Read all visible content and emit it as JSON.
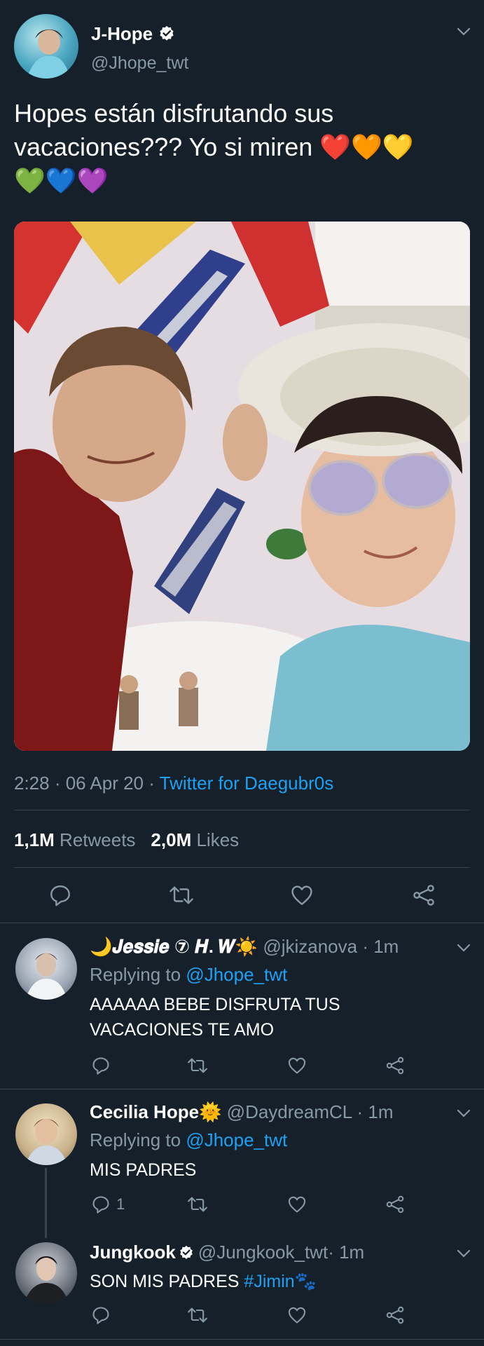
{
  "tweet": {
    "author_name": "J-Hope",
    "author_handle": "@Jhope_twt",
    "text_line1": "Hopes están disfrutando sus",
    "text_line2": "vacaciones??? Yo si miren ❤️🧡💛",
    "text_line3": "💚💙💜",
    "time": "2:28 · 06 Apr 20 · ",
    "source": "Twitter for Daegubr0s",
    "retweets_count": "1,1M",
    "retweets_label": " Retweets",
    "likes_count": "2,0M",
    "likes_label": " Likes"
  },
  "replies": [
    {
      "name": "🌙𝑱𝒆𝒔𝒔𝒊𝒆 ⑦ 𝑯. 𝑾☀️",
      "handle": "@jkizanova",
      "time": " · 1m",
      "replying_prefix": "Replying to ",
      "replying_to": "@Jhope_twt",
      "text_line1": "AAAAAA BEBE DISFRUTA TUS",
      "text_line2": "VACACIONES TE AMO"
    },
    {
      "name": "Cecilia Hope🌞",
      "handle": "@DaydreamCL",
      "time": " · 1m",
      "replying_prefix": "Replying to ",
      "replying_to": "@Jhope_twt",
      "text_line1": "MIS PADRES",
      "reply_count": "1"
    },
    {
      "name": "Jungkook",
      "handle": "@Jungkook_twt",
      "time": " · 1m",
      "text_prefix": "SON MIS PADRES ",
      "hashtag": "#Jimin",
      "text_suffix": "🐾"
    }
  ],
  "colors": {
    "background": "#15202b",
    "divider": "#38444d",
    "muted": "#8899a6",
    "accent": "#1da1f2"
  }
}
